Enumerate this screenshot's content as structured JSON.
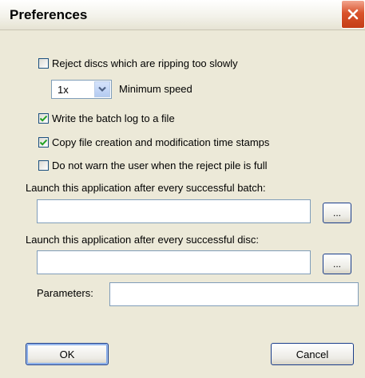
{
  "window": {
    "title": "Preferences",
    "close_icon": "close-icon",
    "accent_close": "#d9532c"
  },
  "options": {
    "reject_slow": {
      "label": "Reject discs which are ripping too slowly",
      "checked": false
    },
    "min_speed": {
      "value": "1x",
      "label": "Minimum speed"
    },
    "write_log": {
      "label": "Write the batch log to a file",
      "checked": true
    },
    "copy_timestamps": {
      "label": "Copy file creation and modification time stamps",
      "checked": true
    },
    "no_warn": {
      "label": "Do not warn the user when the reject pile is full",
      "checked": false
    }
  },
  "launch_batch": {
    "label": "Launch this application after every successful batch:",
    "value": "",
    "browse_label": "..."
  },
  "launch_disc": {
    "label": "Launch this application after every successful disc:",
    "value": "",
    "browse_label": "..."
  },
  "parameters": {
    "label": "Parameters:",
    "value": ""
  },
  "buttons": {
    "ok": "OK",
    "cancel": "Cancel"
  }
}
